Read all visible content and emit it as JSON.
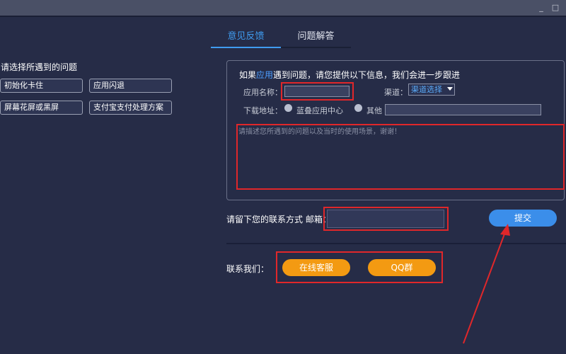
{
  "window": {
    "minimize_glyph": "_",
    "maximize_glyph": "□"
  },
  "tabs": [
    {
      "label": "意见反馈",
      "active": true
    },
    {
      "label": "问题解答",
      "active": false
    }
  ],
  "issues": {
    "heading": "请选择所遇到的问题",
    "options": [
      "初始化卡住",
      "应用闪退",
      "屏幕花屏或黑屏",
      "支付宝支付处理方案"
    ]
  },
  "form": {
    "info_prefix": "如果",
    "info_highlight": "应用",
    "info_suffix": "遇到问题，请您提供以下信息，我们会进一步跟进",
    "app_name_label": "应用名称：",
    "app_name_value": "",
    "channel_label": "渠道：",
    "channel_selected": "渠道选择",
    "download_label": "下载地址：",
    "download_option_1": "蓝叠应用中心",
    "download_option_2": "其他",
    "other_url_value": "",
    "description_placeholder": "请描述您所遇到的问题以及当时的使用场景，谢谢！"
  },
  "contact": {
    "leave_contact_label": "请留下您的联系方式 邮箱：",
    "email_value": "",
    "submit_label": "提交",
    "contact_us_label": "联系我们：",
    "online_service_label": "在线客服",
    "qq_group_label": "QQ群"
  },
  "colors": {
    "accent": "#3f9cf0",
    "annotation_red": "#e0272a",
    "orange": "#f39a12",
    "background": "#262c47"
  }
}
